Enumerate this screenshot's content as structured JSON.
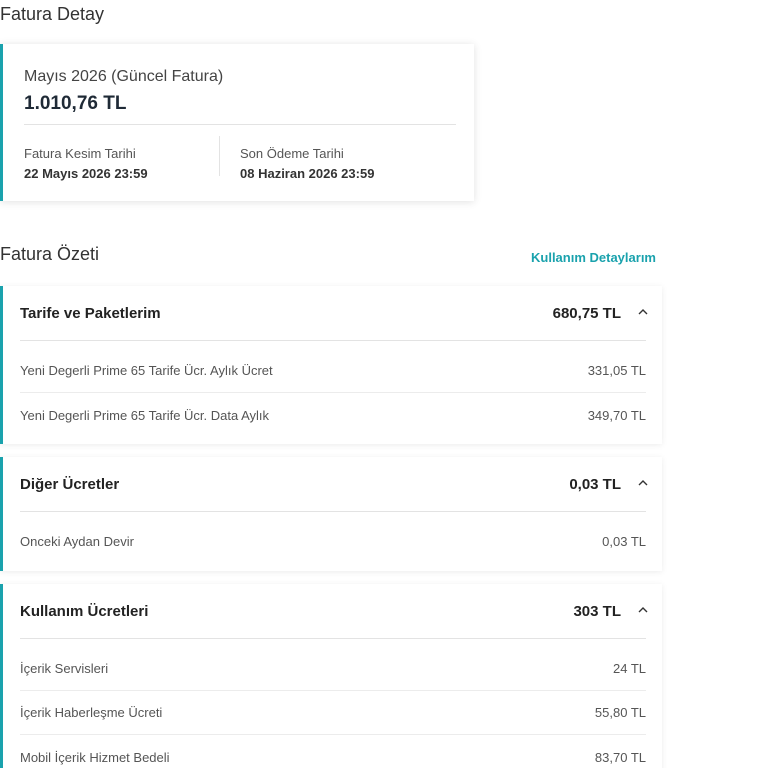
{
  "page_title": "Fatura Detay",
  "invoice": {
    "period": "Mayıs 2026 (Güncel Fatura)",
    "amount": "1.010,76 TL",
    "cut_date_label": "Fatura Kesim Tarihi",
    "cut_date_value": "22 Mayıs 2026 23:59",
    "due_date_label": "Son Ödeme Tarihi",
    "due_date_value": "08 Haziran 2026 23:59"
  },
  "summary": {
    "title": "Fatura Özeti",
    "usage_link": "Kullanım Detaylarım"
  },
  "sections": [
    {
      "title": "Tarife ve Paketlerim",
      "total": "680,75 TL",
      "icon": "chevron-up-icon",
      "items": [
        {
          "label": "Yeni Degerli Prime 65 Tarife Ücr. Aylık Ücret",
          "value": "331,05 TL"
        },
        {
          "label": "Yeni Degerli Prime 65 Tarife Ücr. Data Aylık",
          "value": "349,70 TL"
        }
      ]
    },
    {
      "title": "Diğer Ücretler",
      "total": "0,03 TL",
      "icon": "chevron-up-icon",
      "items": [
        {
          "label": "Onceki Aydan Devir",
          "value": "0,03 TL"
        }
      ]
    },
    {
      "title": "Kullanım Ücretleri",
      "total": "303 TL",
      "icon": "chevron-up-icon",
      "items": [
        {
          "label": "İçerik Servisleri",
          "value": "24 TL"
        },
        {
          "label": "İçerik Haberleşme Ücreti",
          "value": "55,80 TL"
        },
        {
          "label": "Mobil İçerik Hizmet Bedeli",
          "value": "83,70 TL"
        }
      ]
    }
  ],
  "colors": {
    "accent": "#1aa2ad",
    "text": "#333333"
  }
}
